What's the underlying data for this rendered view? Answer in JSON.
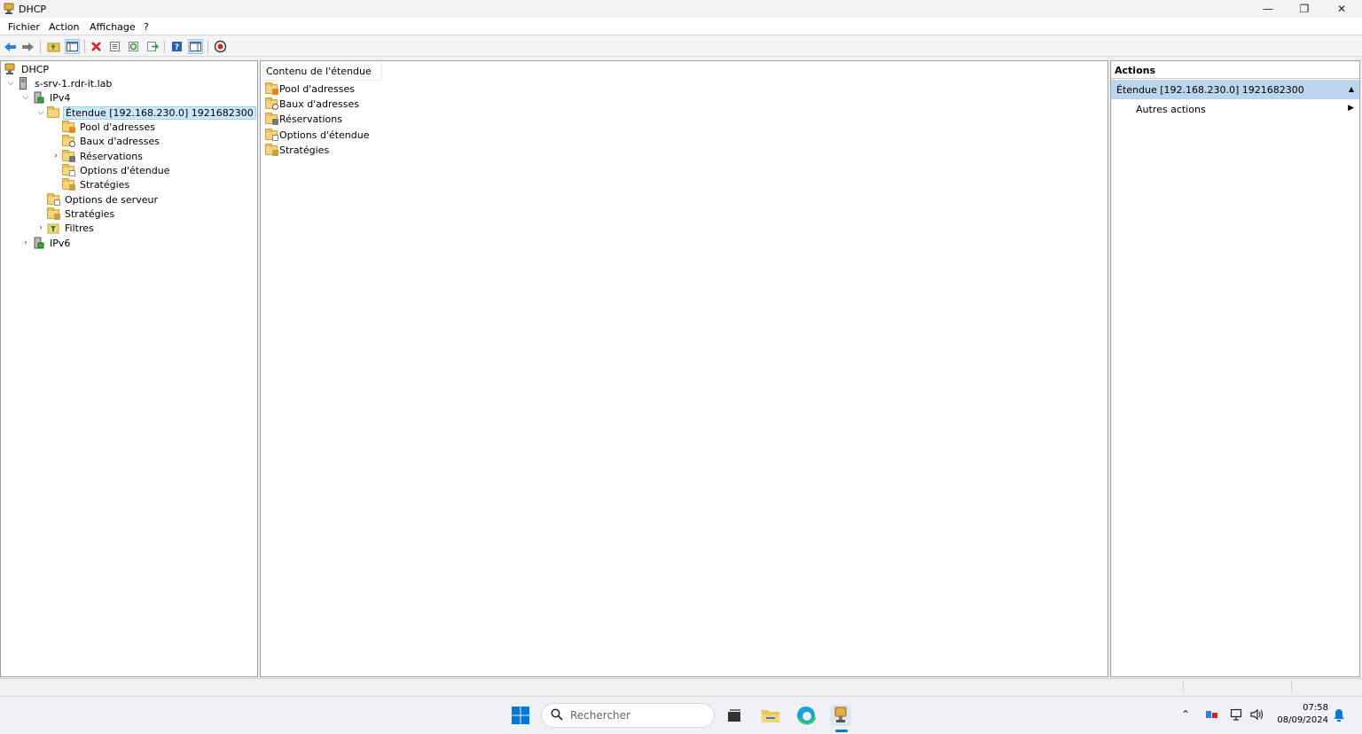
{
  "window": {
    "title": "DHCP",
    "controls": {
      "minimize": "—",
      "restore": "❐",
      "close": "✕"
    }
  },
  "menu": [
    "Fichier",
    "Action",
    "Affichage",
    "?"
  ],
  "toolbar": {
    "icons": [
      "back-arrow-icon",
      "forward-arrow-icon",
      "up-folder-icon",
      "show-hide-tree-icon",
      "delete-icon",
      "properties-icon",
      "refresh-icon",
      "export-list-icon",
      "help-icon",
      "show-hide-action-pane-icon",
      "stop-icon"
    ]
  },
  "tree": {
    "root": "DHCP",
    "server": "s-srv-1.rdr-it.lab",
    "ipv4": "IPv4",
    "scope": "Étendue [192.168.230.0] 1921682300",
    "scope_children": [
      "Pool d'adresses",
      "Baux d'adresses",
      "Réservations",
      "Options d'étendue",
      "Stratégies"
    ],
    "server_options": "Options de serveur",
    "policies": "Stratégies",
    "filters": "Filtres",
    "ipv6": "IPv6"
  },
  "content": {
    "header": "Contenu de l'étendue",
    "items": [
      "Pool d'adresses",
      "Baux d'adresses",
      "Réservations",
      "Options d'étendue",
      "Stratégies"
    ]
  },
  "actions": {
    "header": "Actions",
    "section": "Étendue [192.168.230.0] 1921682300",
    "item": "Autres actions"
  },
  "taskbar": {
    "search_placeholder": "Rechercher",
    "time": "07:58",
    "date": "08/09/2024"
  },
  "colors": {
    "selection": "#cce8ff",
    "actions_section": "#bcd4ec",
    "folder": "#f5d57b",
    "delete_red": "#d42020",
    "windows_blue": "#0078d4"
  }
}
